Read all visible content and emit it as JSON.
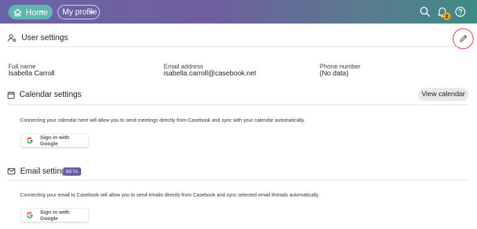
{
  "topbar": {
    "home_label": "Home",
    "profile_label": "My profile",
    "notification_count": "2",
    "icons": [
      "home-icon",
      "chevron-down-icon",
      "search-icon",
      "bell-icon",
      "help-icon"
    ]
  },
  "user_settings": {
    "title": "User settings",
    "fields": [
      {
        "label": "Full name",
        "value": "Isabella Carroll"
      },
      {
        "label": "Email address",
        "value": "isabella.carroll@casebook.net"
      },
      {
        "label": "Phone number",
        "value": "(No data)"
      }
    ]
  },
  "calendar_settings": {
    "title": "Calendar settings",
    "view_button": "View calendar",
    "description": "Connecting your calendar here will allow you to send meetings directly from Casebook and sync with your calendar automatically.",
    "google_button": "Sign in with Google"
  },
  "email_settings": {
    "title": "Email settings",
    "badge": "BETA",
    "description": "Connecting your email to Casebook will allow you to send emails directly from Casebook and sync selected email threads automatically.",
    "google_button": "Sign in with Google"
  },
  "colors": {
    "home_button": "#5fb7b0",
    "beta_badge": "#6b5ba7",
    "highlight_circle": "#e0322f",
    "notification_badge": "#f0a21c"
  }
}
